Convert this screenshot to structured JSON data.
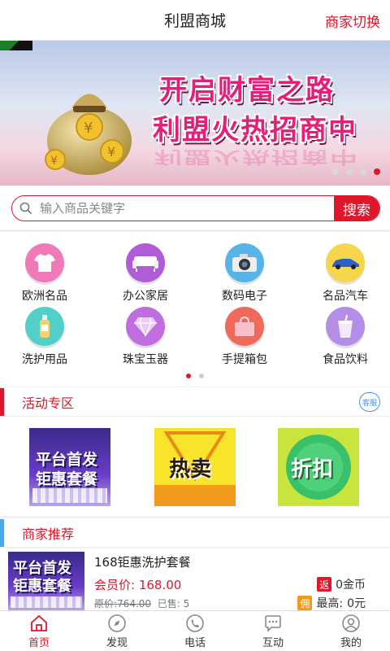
{
  "header": {
    "title": "利盟商城",
    "switch_label": "商家切换"
  },
  "banner": {
    "line1": "开启财富之路",
    "line2": "利盟火热招商中",
    "slides": 4,
    "active_slide": 4
  },
  "search": {
    "placeholder": "输入商品关键字",
    "button_label": "搜索"
  },
  "categories": [
    {
      "label": "欧洲名品",
      "icon": "tshirt-icon",
      "color": "#f07ab8"
    },
    {
      "label": "办公家居",
      "icon": "sofa-icon",
      "color": "#b05cd6"
    },
    {
      "label": "数码电子",
      "icon": "camera-icon",
      "color": "#56b4e8"
    },
    {
      "label": "名品汽车",
      "icon": "car-icon",
      "color": "#f6d64a"
    },
    {
      "label": "洗护用品",
      "icon": "bottle-icon",
      "color": "#52cfc8"
    },
    {
      "label": "珠宝玉器",
      "icon": "diamond-icon",
      "color": "#c06de0"
    },
    {
      "label": "手提箱包",
      "icon": "bag-icon",
      "color": "#f06a5c"
    },
    {
      "label": "食品饮料",
      "icon": "drink-icon",
      "color": "#b48ee6"
    }
  ],
  "sections": {
    "activity": {
      "title": "活动专区",
      "service_label": "客服",
      "accent": "#e0162b"
    },
    "merchant": {
      "title": "商家推荐",
      "accent": "#4fa4f0"
    }
  },
  "activity_items": [
    {
      "text_top": "平台首发",
      "text_bottom": "钜惠套餐",
      "icon": "promo-package-image"
    },
    {
      "text": "热卖",
      "icon": "hot-sale-image"
    },
    {
      "text": "折扣",
      "icon": "discount-image"
    }
  ],
  "product": {
    "name": "168钜惠洗护套餐",
    "member_price_label": "会员价:",
    "member_price": "168.00",
    "original_label": "原价:",
    "original_price": "764.00",
    "sold_label": "已售:",
    "sold": "5",
    "rebate_tag": "返",
    "rebate_value": "0金币",
    "commission_tag": "佣",
    "commission_label": "最高:",
    "commission_value": "0元",
    "img_top": "平台首发",
    "img_bottom": "钜惠套餐"
  },
  "tabs": [
    {
      "label": "首页",
      "icon": "home-icon",
      "active": true
    },
    {
      "label": "发现",
      "icon": "compass-icon",
      "active": false
    },
    {
      "label": "电话",
      "icon": "phone-icon",
      "active": false
    },
    {
      "label": "互动",
      "icon": "chat-icon",
      "active": false
    },
    {
      "label": "我的",
      "icon": "user-icon",
      "active": false
    }
  ],
  "colors": {
    "brand": "#e0162b",
    "merchant_accent": "#4fa4f0"
  }
}
